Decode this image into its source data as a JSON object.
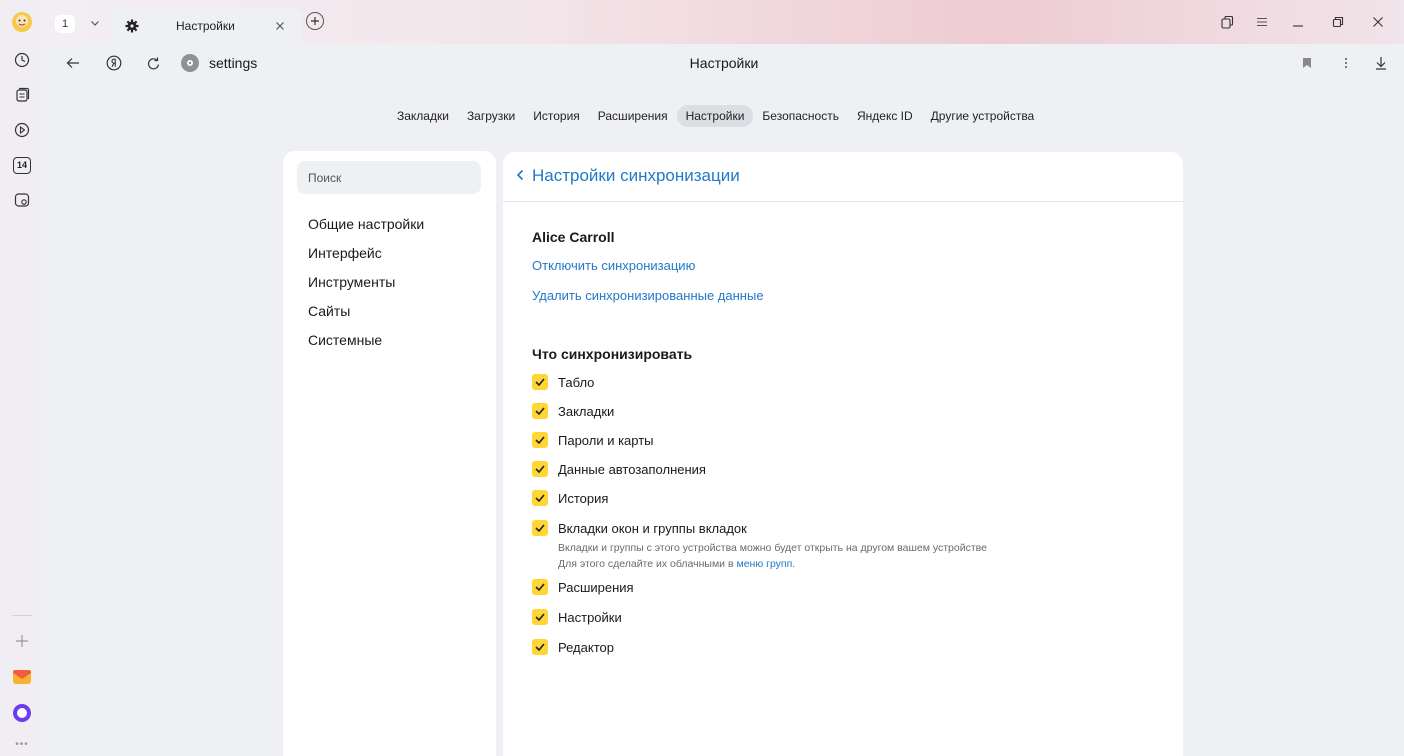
{
  "tabstrip": {
    "tab_count": "1",
    "active_tab_title": "Настройки"
  },
  "addressbar": {
    "url": "settings",
    "page_title": "Настройки"
  },
  "sidebar": {
    "calendar_day": "14"
  },
  "topnav": {
    "items": [
      {
        "label": "Закладки"
      },
      {
        "label": "Загрузки"
      },
      {
        "label": "История"
      },
      {
        "label": "Расширения"
      },
      {
        "label": "Настройки"
      },
      {
        "label": "Безопасность"
      },
      {
        "label": "Яндекс ID"
      },
      {
        "label": "Другие устройства"
      }
    ],
    "active": "Настройки"
  },
  "leftnav": {
    "search_placeholder": "Поиск",
    "items": [
      {
        "label": "Общие настройки"
      },
      {
        "label": "Интерфейс"
      },
      {
        "label": "Инструменты"
      },
      {
        "label": "Сайты"
      },
      {
        "label": "Системные"
      }
    ]
  },
  "sync": {
    "back_label": "Настройки синхронизации",
    "user_name": "Alice Carroll",
    "disable_link": "Отключить синхронизацию",
    "delete_link": "Удалить синхронизированные данные",
    "what_heading": "Что синхронизировать",
    "options": [
      {
        "label": "Табло",
        "checked": true
      },
      {
        "label": "Закладки",
        "checked": true
      },
      {
        "label": "Пароли и карты",
        "checked": true
      },
      {
        "label": "Данные автозаполнения",
        "checked": true
      },
      {
        "label": "История",
        "checked": true
      },
      {
        "label": "Вкладки окон и группы вкладок",
        "checked": true
      },
      {
        "label": "Расширения",
        "checked": true
      },
      {
        "label": "Настройки",
        "checked": true
      },
      {
        "label": "Редактор",
        "checked": true
      }
    ],
    "tabs_hint_line1": "Вкладки и группы с этого устройства можно будет открыть на другом вашем устройстве",
    "tabs_hint_line2_prefix": "Для этого сделайте их облачными в ",
    "tabs_hint_link": "меню групп",
    "tabs_hint_suffix": "."
  },
  "colors": {
    "accent_link": "#2279c7",
    "checkbox": "#ffd634",
    "page_bg": "#eef0f4"
  }
}
